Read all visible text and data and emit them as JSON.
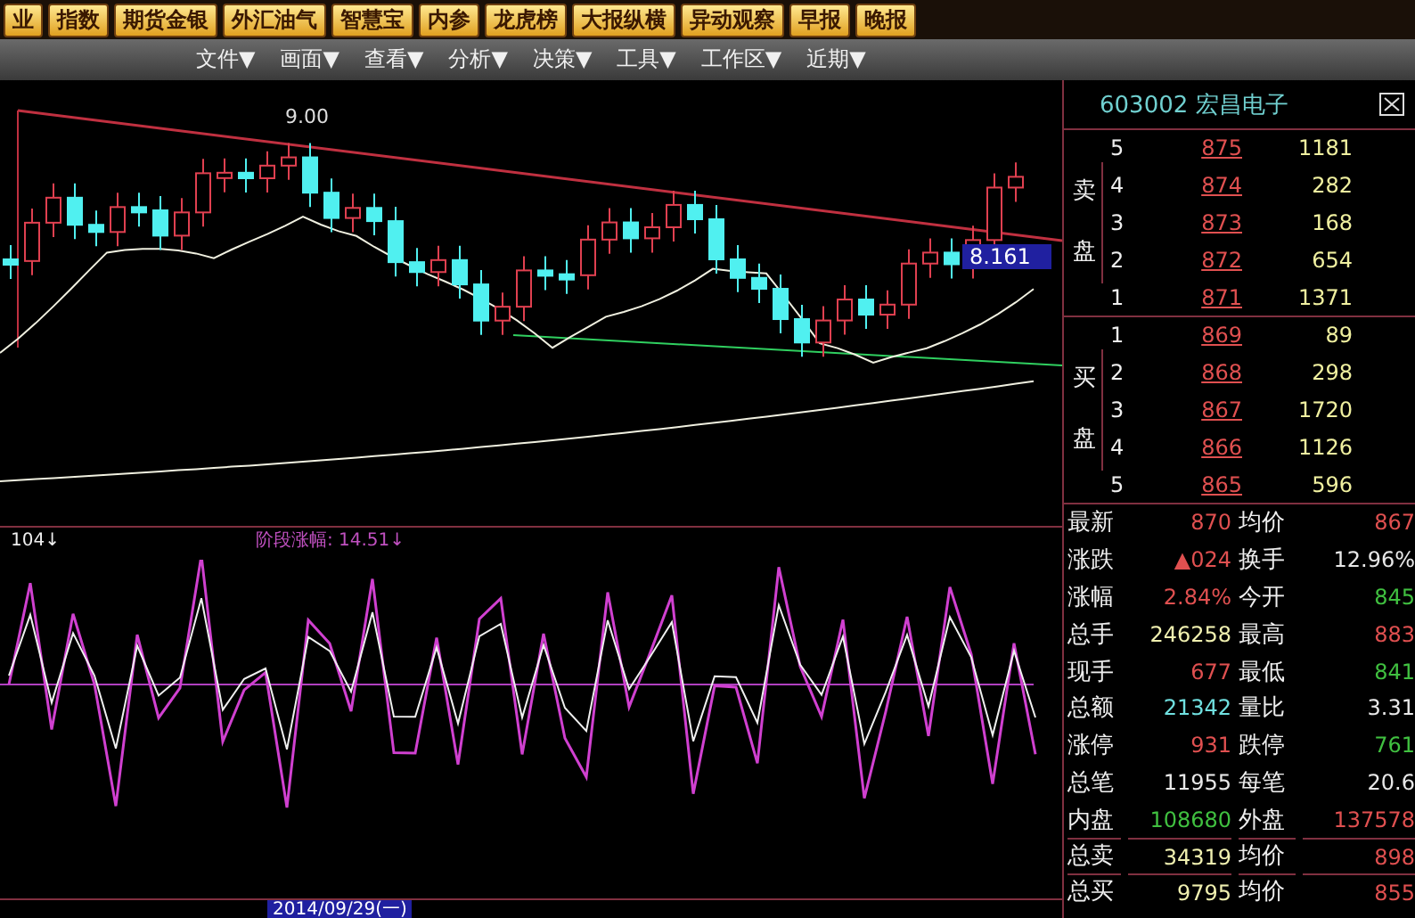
{
  "toolbar": {
    "buttons": [
      "业",
      "指数",
      "期货金银",
      "外汇油气",
      "智慧宝",
      "内参",
      "龙虎榜",
      "大报纵横",
      "异动观察",
      "早报",
      "晚报"
    ]
  },
  "menu": {
    "items": [
      "文件▼",
      "画面▼",
      "查看▼",
      "分析▼",
      "决策▼",
      "工具▼",
      "工作区▼",
      "近期▼"
    ]
  },
  "chart": {
    "high_label": "9.00",
    "price_tag": "8.161"
  },
  "indicator": {
    "period_label": "104↓",
    "gain_label": "阶段涨幅: 14.51↓"
  },
  "date_axis": {
    "date": "2014/09/29(一)"
  },
  "quote": {
    "title": "603002 宏昌电子",
    "sell_label": "卖盘",
    "buy_label": "买盘",
    "sell_rows": [
      {
        "level": "5",
        "price": "875",
        "volume": "1181"
      },
      {
        "level": "4",
        "price": "874",
        "volume": "282"
      },
      {
        "level": "3",
        "price": "873",
        "volume": "168"
      },
      {
        "level": "2",
        "price": "872",
        "volume": "654"
      },
      {
        "level": "1",
        "price": "871",
        "volume": "1371"
      }
    ],
    "buy_rows": [
      {
        "level": "1",
        "price": "869",
        "volume": "89"
      },
      {
        "level": "2",
        "price": "868",
        "volume": "298"
      },
      {
        "level": "3",
        "price": "867",
        "volume": "1720"
      },
      {
        "level": "4",
        "price": "866",
        "volume": "1126"
      },
      {
        "level": "5",
        "price": "865",
        "volume": "596"
      }
    ],
    "stats": [
      {
        "label": "最新",
        "value": "870",
        "color": "#e05050"
      },
      {
        "label": "均价",
        "value": "867",
        "color": "#e05050"
      },
      {
        "label": "涨跌",
        "value": "▲024",
        "color": "#e05050"
      },
      {
        "label": "换手",
        "value": "12.96%",
        "color": "#e8e8e8"
      },
      {
        "label": "涨幅",
        "value": "2.84%",
        "color": "#e05050"
      },
      {
        "label": "今开",
        "value": "845",
        "color": "#40c040"
      },
      {
        "label": "总手",
        "value": "246258",
        "color": "#f0f0b0"
      },
      {
        "label": "最高",
        "value": "883",
        "color": "#e05050"
      },
      {
        "label": "现手",
        "value": "677",
        "color": "#e05050"
      },
      {
        "label": "最低",
        "value": "841",
        "color": "#40c040"
      },
      {
        "label": "总额",
        "value": "21342",
        "color": "#70e0e0"
      },
      {
        "label": "量比",
        "value": "3.31",
        "color": "#e8e8e8"
      },
      {
        "label": "涨停",
        "value": "931",
        "color": "#e05050"
      },
      {
        "label": "跌停",
        "value": "761",
        "color": "#40c040"
      },
      {
        "label": "总笔",
        "value": "11955",
        "color": "#e8e8e8"
      },
      {
        "label": "每笔",
        "value": "20.6",
        "color": "#e8e8e8"
      },
      {
        "label": "内盘",
        "value": "108680",
        "color": "#40c040"
      },
      {
        "label": "外盘",
        "value": "137578",
        "color": "#e05050"
      },
      {
        "label": "总卖",
        "value": "34319",
        "color": "#f0f0b0"
      },
      {
        "label": "均价",
        "value": "898",
        "color": "#e05050"
      },
      {
        "label": "总买",
        "value": "9795",
        "color": "#f0f0b0"
      },
      {
        "label": "均价",
        "value": "855",
        "color": "#e05050"
      }
    ]
  }
}
